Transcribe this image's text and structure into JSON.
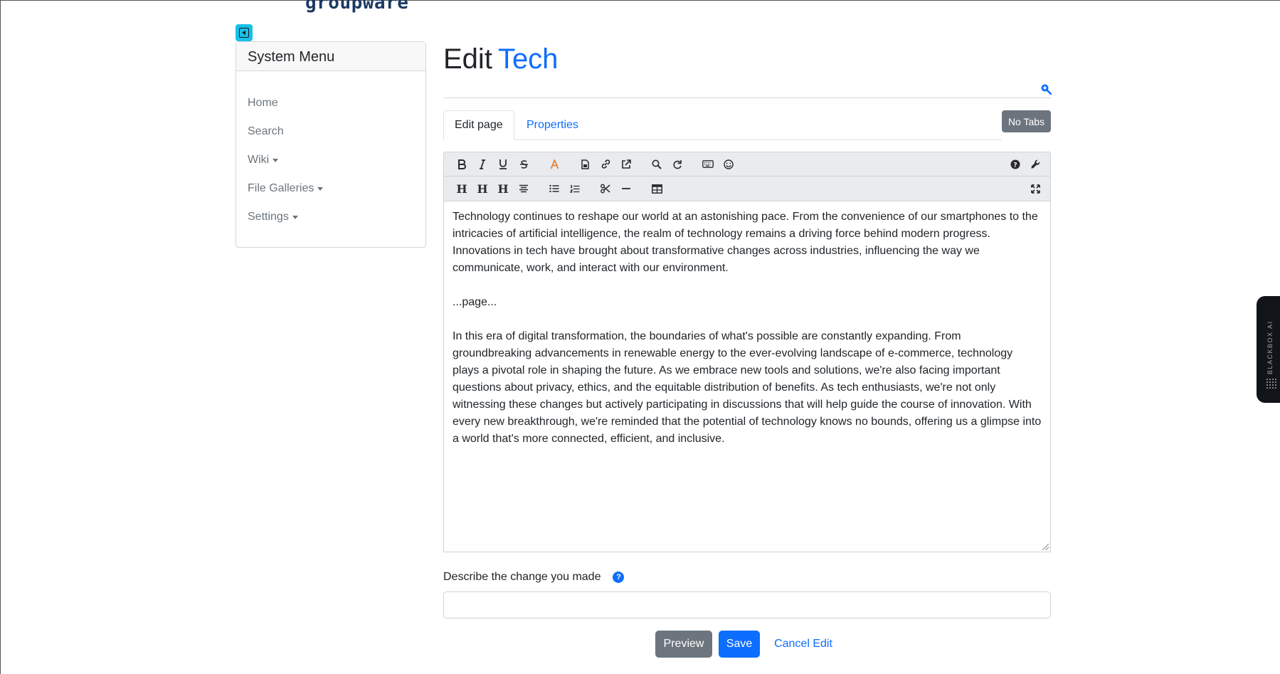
{
  "brand": {
    "logo_text": "groupware"
  },
  "sidebar": {
    "title": "System Menu",
    "items": [
      {
        "label": "Home",
        "has_caret": false
      },
      {
        "label": "Search",
        "has_caret": false
      },
      {
        "label": "Wiki",
        "has_caret": true
      },
      {
        "label": "File Galleries",
        "has_caret": true
      },
      {
        "label": "Settings",
        "has_caret": true
      }
    ]
  },
  "page": {
    "title_prefix": "Edit",
    "title_name": "Tech"
  },
  "tabs": {
    "items": [
      {
        "label": "Edit page",
        "active": true
      },
      {
        "label": "Properties",
        "active": false
      }
    ],
    "no_tabs_button": "No Tabs"
  },
  "toolbar": {
    "row1": [
      "bold-icon",
      "italic-icon",
      "underline-icon",
      "strikethrough-icon",
      "text-color-icon",
      "file-icon",
      "link-icon",
      "external-link-icon",
      "find-icon",
      "redo-icon",
      "keyboard-icon",
      "smiley-icon",
      "help-icon",
      "wrench-icon"
    ],
    "row2": [
      "heading1-icon",
      "heading2-icon",
      "heading3-icon",
      "align-center-icon",
      "bullet-list-icon",
      "numbered-list-icon",
      "cut-icon",
      "horizontal-rule-icon",
      "table-icon",
      "fullscreen-icon"
    ],
    "color_accent": "#e8833a"
  },
  "editor": {
    "paragraphs": [
      "Technology continues to reshape our world at an astonishing pace. From the convenience of our smartphones to the intricacies of artificial intelligence, the realm of technology remains a driving force behind modern progress. Innovations in tech have brought about transformative changes across industries, influencing the way we communicate, work, and interact with our environment.",
      "...page...",
      "In this era of digital transformation, the boundaries of what's possible are constantly expanding. From groundbreaking advancements in renewable energy to the ever-evolving landscape of e-commerce, technology plays a pivotal role in shaping the future. As we embrace new tools and solutions, we're also facing important questions about privacy, ethics, and the equitable distribution of benefits. As tech enthusiasts, we're not only witnessing these changes but actively participating in discussions that will help guide the course of innovation. With every new breakthrough, we're reminded that the potential of technology knows no bounds, offering us a glimpse into a world that's more connected, efficient, and inclusive."
    ]
  },
  "describe": {
    "label": "Describe the change you made",
    "help_glyph": "?",
    "value": "",
    "placeholder": ""
  },
  "actions": {
    "preview": "Preview",
    "save": "Save",
    "cancel": "Cancel Edit"
  },
  "ai_tab": {
    "label": "BLACKBOX AI"
  },
  "colors": {
    "primary": "#0d6efd",
    "secondary": "#6c757d",
    "toggle": "#17c1e8"
  }
}
